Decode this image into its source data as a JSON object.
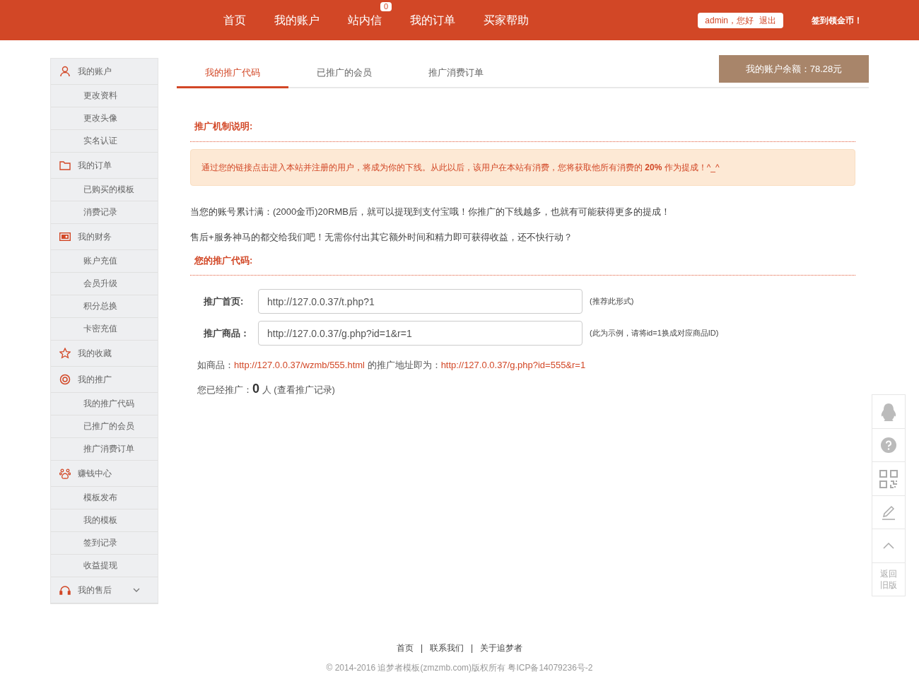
{
  "header": {
    "nav": [
      {
        "label": "首页"
      },
      {
        "label": "我的账户"
      },
      {
        "label": "站内信",
        "badge": "0"
      },
      {
        "label": "我的订单"
      },
      {
        "label": "买家帮助"
      }
    ],
    "user": {
      "greeting": "admin，您好",
      "logout": "退出"
    },
    "sign_in": "签到领金币！"
  },
  "sidebar": {
    "groups": [
      {
        "label": "我的账户",
        "expanded": true,
        "children": [
          "更改资料",
          "更改头像",
          "实名认证"
        ]
      },
      {
        "label": "我的订单",
        "expanded": true,
        "children": [
          "已购买的模板",
          "消费记录"
        ]
      },
      {
        "label": "我的财务",
        "expanded": true,
        "children": [
          "账户充值",
          "会员升级",
          "积分总换",
          "卡密充值"
        ]
      },
      {
        "label": "我的收藏",
        "expanded": true
      },
      {
        "label": "我的推广",
        "expanded": true,
        "children": [
          "我的推广代码",
          "已推广的会员",
          "推广消费订单"
        ]
      },
      {
        "label": "赚钱中心",
        "expanded": true,
        "children": [
          "模板发布",
          "我的模板",
          "签到记录",
          "收益提现"
        ]
      },
      {
        "label": "我的售后",
        "expanded": false
      }
    ]
  },
  "tabs": [
    {
      "label": "我的推广代码",
      "selected": true
    },
    {
      "label": "已推广的会员",
      "selected": false
    },
    {
      "label": "推广消费订单",
      "selected": false
    }
  ],
  "balance": "我的账户余额：78.28元",
  "mechanism": {
    "title": "推广机制说明:",
    "notice": "通过您的链接点击进入本站并注册的用户，将成为你的下线。从此以后，该用户在本站有消费，您将获取他所有消费的 **20%** 作为提成！^_^",
    "paragraphs": [
      "当您的账号累计满：(2000金币)20RMB后，就可以提现到支付宝哦！你推广的下线越多，也就有可能获得更多的提成！",
      "售后+服务神马的都交给我们吧！无需你付出其它额外时间和精力即可获得收益，还不快行动？"
    ]
  },
  "code": {
    "title": "您的推广代码:",
    "fields": [
      {
        "label": "推广首页:",
        "value": "http://127.0.0.37/t.php?1",
        "hint": "(推荐此形式)"
      },
      {
        "label": "推广商品：",
        "value": "http://127.0.0.37/g.php?id=1&r=1",
        "hint": "(此为示例，请将id=1换成对应商品ID)"
      }
    ],
    "example": {
      "prefix": "如商品：",
      "product_link": "http://127.0.0.37/wzmb/555.html",
      "middle": " 的推广地址即为：",
      "promo_link": "http://127.0.0.37/g.php?id=555&r=1"
    },
    "count": {
      "label": "您已经推广：",
      "value": "0",
      "unit": "人",
      "link": "(查看推广记录)"
    }
  },
  "side_tools": {
    "back_label": "返回旧版"
  },
  "footer": {
    "links": [
      "首页",
      "联系我们",
      "关于追梦者"
    ],
    "separator": "|",
    "copyright": "© 2014-2016 追梦者模板(zmzmb.com)版权所有 粤ICP备14079236号-2"
  }
}
